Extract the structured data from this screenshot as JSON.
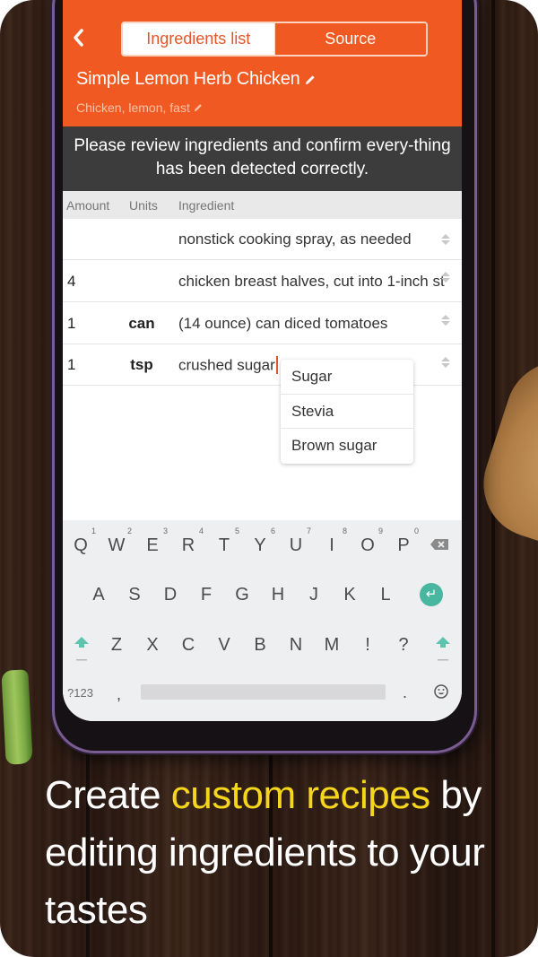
{
  "header": {
    "back_icon": "chevron-left-icon",
    "tabs": [
      {
        "label": "Ingredients list",
        "active": true
      },
      {
        "label": "Source",
        "active": false
      }
    ],
    "recipe_title": "Simple Lemon Herb Chicken",
    "tags": "Chicken, lemon, fast",
    "edit_icon": "pencil-icon"
  },
  "notice": "Please review ingredients and confirm every-thing has been detected correctly.",
  "table": {
    "columns": [
      "Amount",
      "Units",
      "Ingredient"
    ],
    "rows": [
      {
        "amount": "",
        "units": "",
        "ingredient": "nonstick cooking spray, as needed"
      },
      {
        "amount": "4",
        "units": "",
        "ingredient": "chicken breast halves, cut into 1-inch st"
      },
      {
        "amount": "1",
        "units": "can",
        "ingredient": "(14 ounce) can diced tomatoes"
      },
      {
        "amount": "1",
        "units": "tsp",
        "ingredient": "crushed sugar"
      }
    ]
  },
  "suggestions": [
    "Sugar",
    "Stevia",
    "Brown sugar"
  ],
  "keyboard": {
    "row1": [
      "Q",
      "W",
      "E",
      "R",
      "T",
      "Y",
      "U",
      "I",
      "O",
      "P"
    ],
    "row1_hints": [
      "1",
      "2",
      "3",
      "4",
      "5",
      "6",
      "7",
      "8",
      "9",
      "0"
    ],
    "row2": [
      "A",
      "S",
      "D",
      "F",
      "G",
      "H",
      "J",
      "K",
      "L"
    ],
    "row3": [
      "Z",
      "X",
      "C",
      "V",
      "B",
      "N",
      "M",
      "!",
      "?"
    ],
    "symbols_label": "?123",
    "comma": ",",
    "period": ".",
    "accent_color": "#49b6a0"
  },
  "caption": {
    "before": "Create ",
    "highlight": "custom recipes",
    "after": " by editing ingredients to your tastes",
    "highlight_color": "#f6d61c"
  },
  "colors": {
    "brand_orange": "#f05a22",
    "notice_bg": "#3d3c3c"
  }
}
